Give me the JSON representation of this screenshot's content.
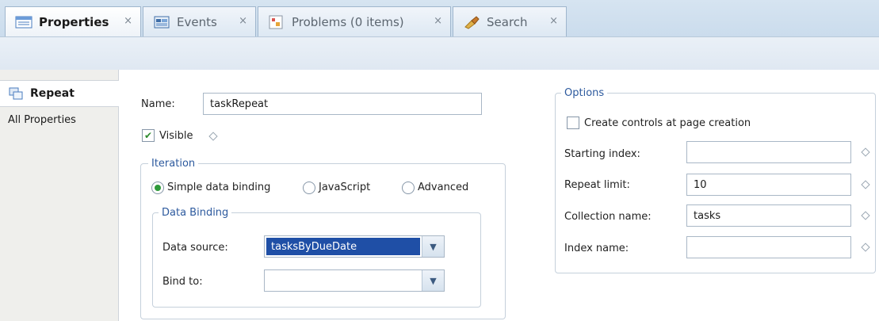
{
  "tabs": [
    {
      "label": "Properties",
      "close": "×",
      "icon": "properties-icon"
    },
    {
      "label": "Events",
      "close": "×",
      "icon": "events-icon"
    },
    {
      "label": "Problems (0 items)",
      "close": "×",
      "icon": "problems-icon"
    },
    {
      "label": "Search",
      "close": "×",
      "icon": "search-icon"
    }
  ],
  "nav": {
    "items": [
      {
        "label": "Repeat",
        "icon": "repeat-icon",
        "selected": true
      },
      {
        "label": "All Properties",
        "selected": false
      }
    ]
  },
  "form": {
    "name_label": "Name:",
    "name_value": "taskRepeat",
    "visible_label": "Visible",
    "visible_checked": true
  },
  "iteration": {
    "title": "Iteration",
    "options": [
      "Simple data binding",
      "JavaScript",
      "Advanced"
    ],
    "selected": "Simple data binding"
  },
  "data_binding": {
    "title": "Data Binding",
    "data_source_label": "Data source:",
    "data_source_value": "tasksByDueDate",
    "bind_to_label": "Bind to:",
    "bind_to_value": ""
  },
  "options": {
    "title": "Options",
    "create_controls_label": "Create controls at page creation",
    "create_controls_checked": false,
    "starting_index_label": "Starting index:",
    "starting_index_value": "",
    "repeat_limit_label": "Repeat limit:",
    "repeat_limit_value": "10",
    "collection_name_label": "Collection name:",
    "collection_name_value": "tasks",
    "index_name_label": "Index name:",
    "index_name_value": ""
  },
  "colors": {
    "accent": "#2d5a9e",
    "selection": "#1f4fa6",
    "tabbar": "#c9dbec"
  }
}
